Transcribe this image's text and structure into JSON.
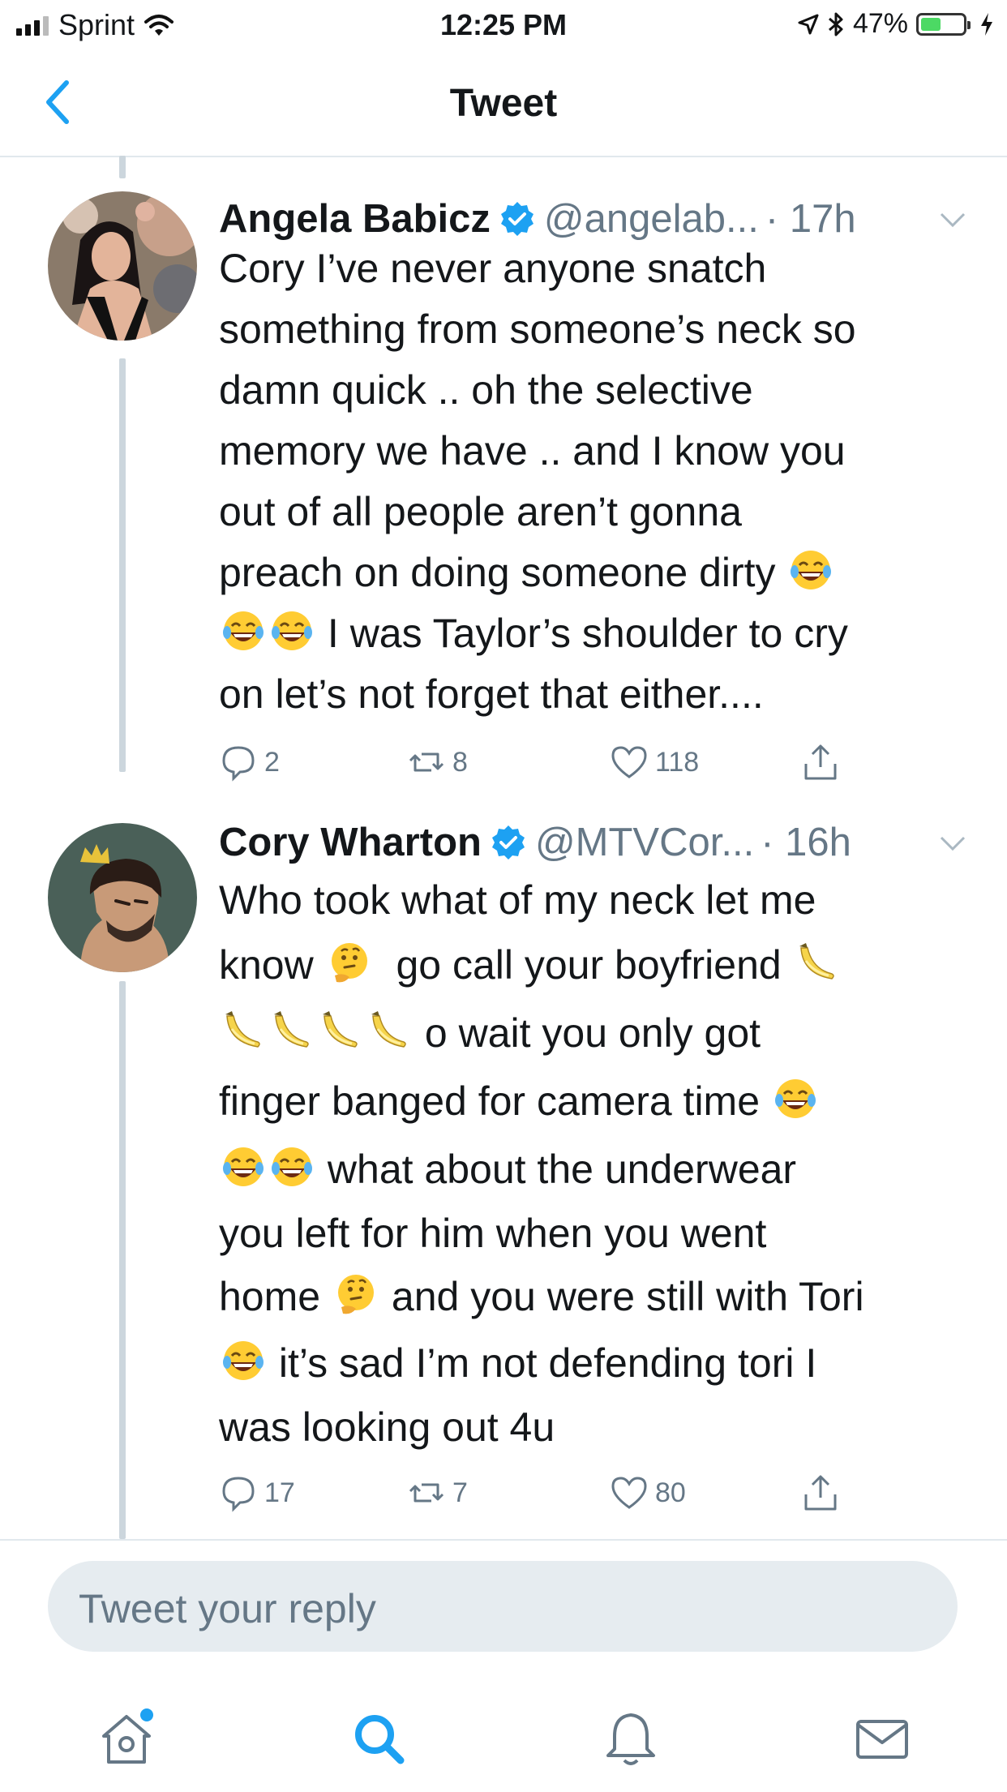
{
  "status_bar": {
    "carrier": "Sprint",
    "time": "12:25 PM",
    "battery_percent": "47%",
    "battery_level": 0.47,
    "icons": [
      "signal-bars-icon",
      "wifi-icon",
      "location-arrow-icon",
      "bluetooth-icon",
      "battery-icon",
      "charging-bolt-icon"
    ]
  },
  "nav": {
    "title": "Tweet",
    "back_icon": "chevron-left-icon"
  },
  "colors": {
    "accent": "#1da1f2",
    "secondary_text": "#657786",
    "divider": "#e1e8ed",
    "thread_line": "#ccd6dd",
    "reply_field": "#e6ecf0",
    "verified": "#1da1f2"
  },
  "tweets": [
    {
      "name": "Angela Babicz",
      "handle": "@angelab...",
      "time": "· 17h",
      "verified": true,
      "lines": [
        "Cory I’ve never anyone snatch",
        "something from someone’s neck so",
        "damn quick .. oh the selective",
        "memory we have .. and I know you",
        "out of all people aren’t gonna",
        "preach on doing someone dirty",
        "I was Taylor’s shoulder to cry",
        "on let’s not forget that either...."
      ],
      "replies": "2",
      "retweets": "8",
      "likes": "118"
    },
    {
      "name": "Cory Wharton",
      "handle": "@MTVCor...",
      "time": "· 16h",
      "verified": true,
      "lines": [
        "Who took what of my neck let me",
        "know",
        "go call your boyfriend",
        "o wait you only got",
        "finger banged for camera time",
        "what about the underwear",
        "you left for him when you went",
        "home",
        "and you were still with Tori",
        "it’s sad I’m not defending tori I",
        "was looking out 4u"
      ],
      "replies": "17",
      "retweets": "7",
      "likes": "80"
    }
  ],
  "reply": {
    "placeholder": "Tweet your reply"
  },
  "tabbar": {
    "icons": [
      "home-icon",
      "search-icon",
      "notifications-bell-icon",
      "messages-envelope-icon"
    ],
    "active": "search-icon"
  }
}
